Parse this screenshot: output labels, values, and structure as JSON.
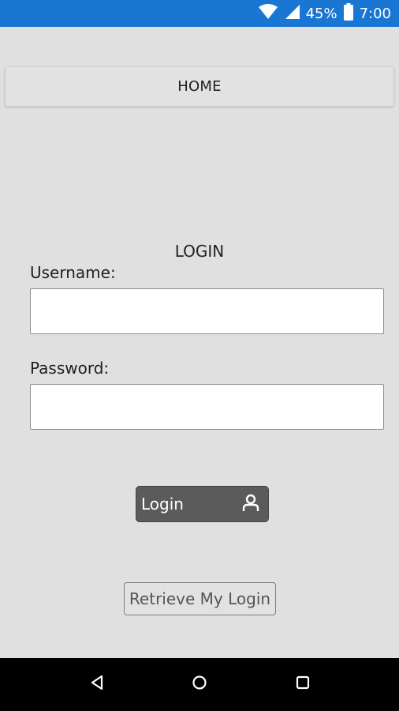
{
  "status_bar": {
    "battery_percent": "45%",
    "time": "7:00",
    "icons": [
      "wifi-icon",
      "signal-icon",
      "battery-icon"
    ],
    "background_color": "#1976d2"
  },
  "header": {
    "home_label": "HOME"
  },
  "form": {
    "title": "LOGIN",
    "username_label": "Username:",
    "username_value": "",
    "password_label": "Password:",
    "password_value": "",
    "login_button_label": "Login",
    "login_button_icon": "user-icon",
    "retrieve_button_label": "Retrieve My Login"
  },
  "nav_bar": {
    "buttons": [
      "back-icon",
      "home-icon",
      "recents-icon"
    ]
  }
}
